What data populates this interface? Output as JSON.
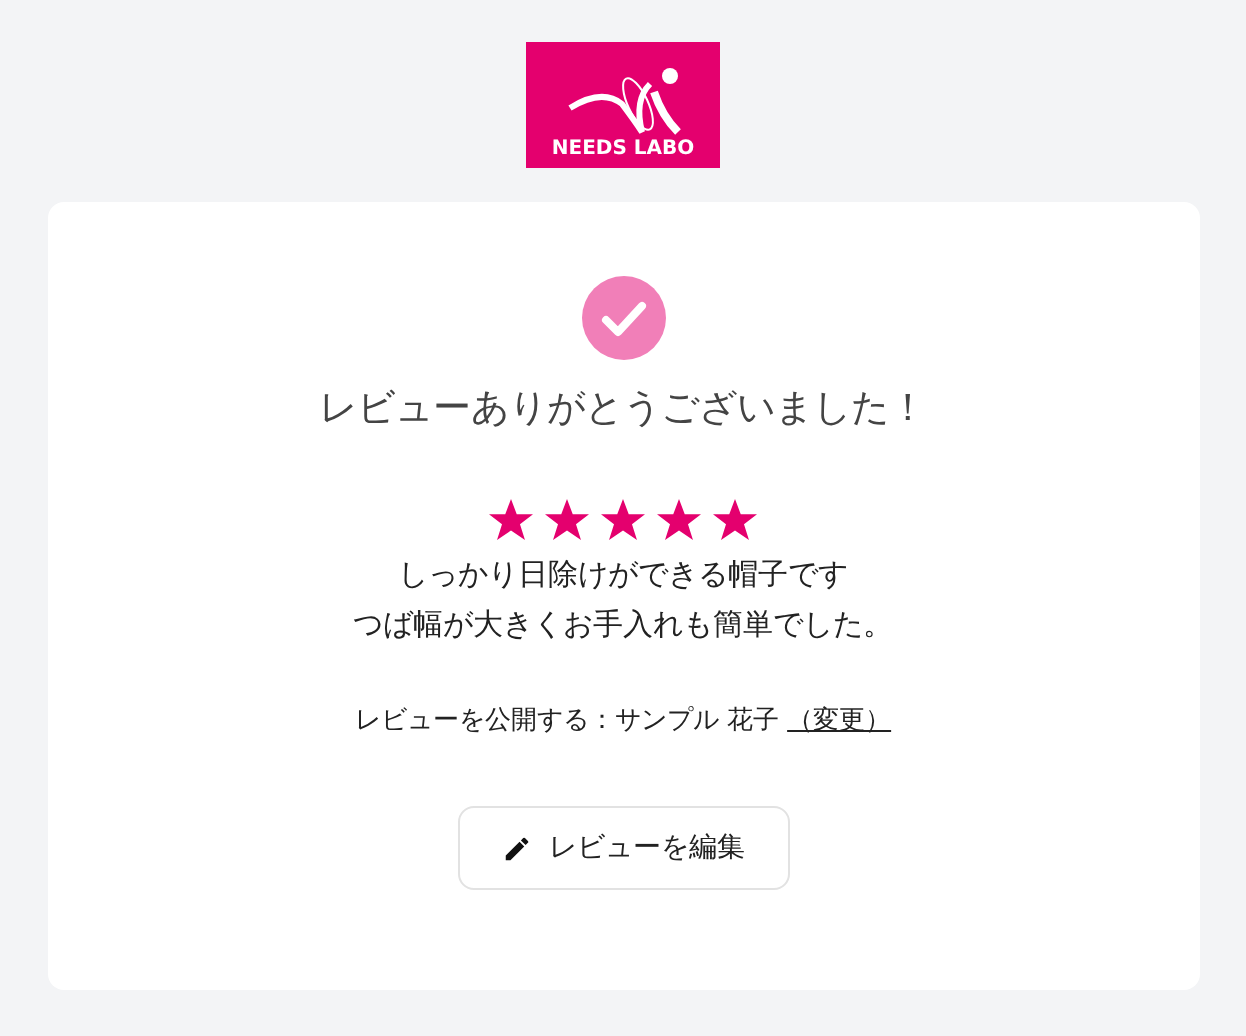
{
  "logo": {
    "text": "NEEDS LABO"
  },
  "message": "レビューありがとうございました！",
  "review": {
    "stars": 5,
    "comment_lines": [
      "しっかり日除けができる帽子です",
      "つば幅が大きくお手入れも簡単でした。"
    ]
  },
  "publish": {
    "label": "レビューを公開する：サンプル 花子",
    "link": "（変更）"
  },
  "edit_button": {
    "label": "レビューを編集"
  }
}
